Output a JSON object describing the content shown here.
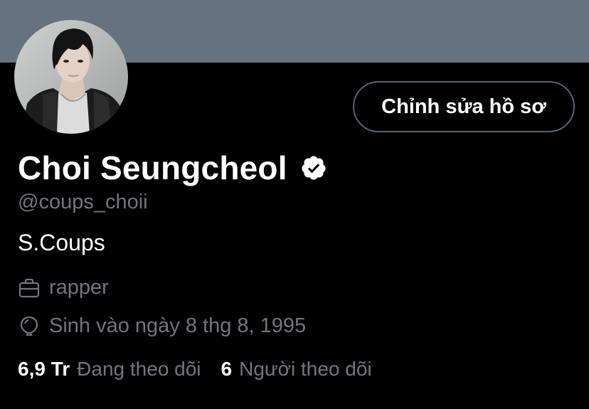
{
  "header": {
    "banner_color": "#66737f"
  },
  "profile": {
    "display_name": "Choi Seungcheol",
    "verified": true,
    "handle": "@coups_choii",
    "bio": "S.Coups",
    "job": "rapper",
    "birth": "Sinh vào ngày 8 thg 8, 1995"
  },
  "actions": {
    "edit_profile_label": "Chỉnh sửa hồ sơ"
  },
  "stats": {
    "following_count": "6,9 Tr",
    "following_label": "Đang theo dõi",
    "followers_count": "6",
    "followers_label": "Người theo dõi"
  },
  "icons": {
    "verified": "verified-badge-icon",
    "job": "briefcase-icon",
    "birth": "balloon-icon"
  },
  "colors": {
    "background": "#000000",
    "primary_text": "#ffffff",
    "secondary_text": "#71767b",
    "button_border": "#536471"
  }
}
